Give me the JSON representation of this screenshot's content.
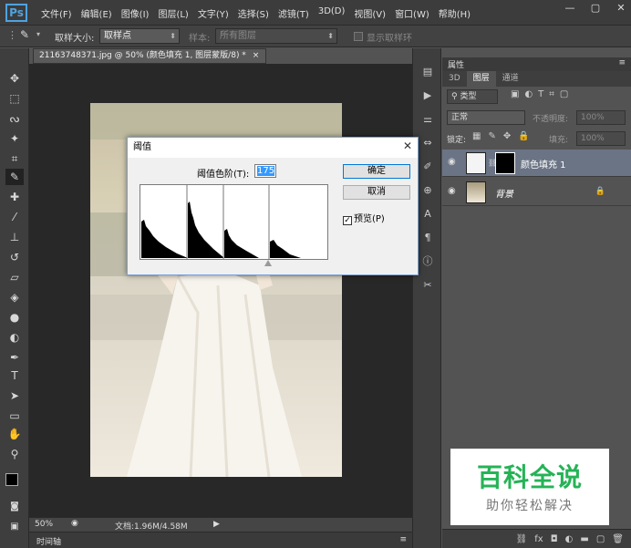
{
  "app": {
    "logo": "Ps"
  },
  "menu": [
    "文件(F)",
    "编辑(E)",
    "图像(I)",
    "图层(L)",
    "文字(Y)",
    "选择(S)",
    "滤镜(T)",
    "3D(D)",
    "视图(V)",
    "窗口(W)",
    "帮助(H)"
  ],
  "window_controls": {
    "minimize": "—",
    "restore": "▢",
    "close": "✕"
  },
  "options": {
    "sample_size_label": "取样大小:",
    "sample_size_value": "取样点",
    "sample_label": "样本:",
    "sample_value": "所有图层",
    "show_ring_label": "显示取样环"
  },
  "document": {
    "tab_title": "21163748371.jpg @ 50% (颜色填充 1, 图层蒙版/8) *",
    "tab_close": "×"
  },
  "status": {
    "zoom": "50%",
    "doc_info": "文档:1.96M/4.58M",
    "timeline": "时间轴"
  },
  "panel": {
    "header": "属性",
    "tabs": [
      "3D",
      "图层",
      "通道"
    ],
    "kind_filter": "类型",
    "blend_mode": "正常",
    "opacity_label": "不透明度:",
    "opacity_value": "100%",
    "lock_label": "锁定:",
    "fill_label": "填充:",
    "fill_value": "100%",
    "layers": [
      {
        "name": "颜色填充 1",
        "selected": true
      },
      {
        "name": "背景",
        "selected": false
      }
    ]
  },
  "dialog": {
    "title": "阈值",
    "threshold_label": "阈值色阶(T):",
    "threshold_value": "175",
    "ok": "确定",
    "cancel": "取消",
    "preview_label": "预览(P)",
    "preview_checked": true
  },
  "watermark": {
    "main": "百科全说",
    "sub": "助你轻松解决"
  }
}
